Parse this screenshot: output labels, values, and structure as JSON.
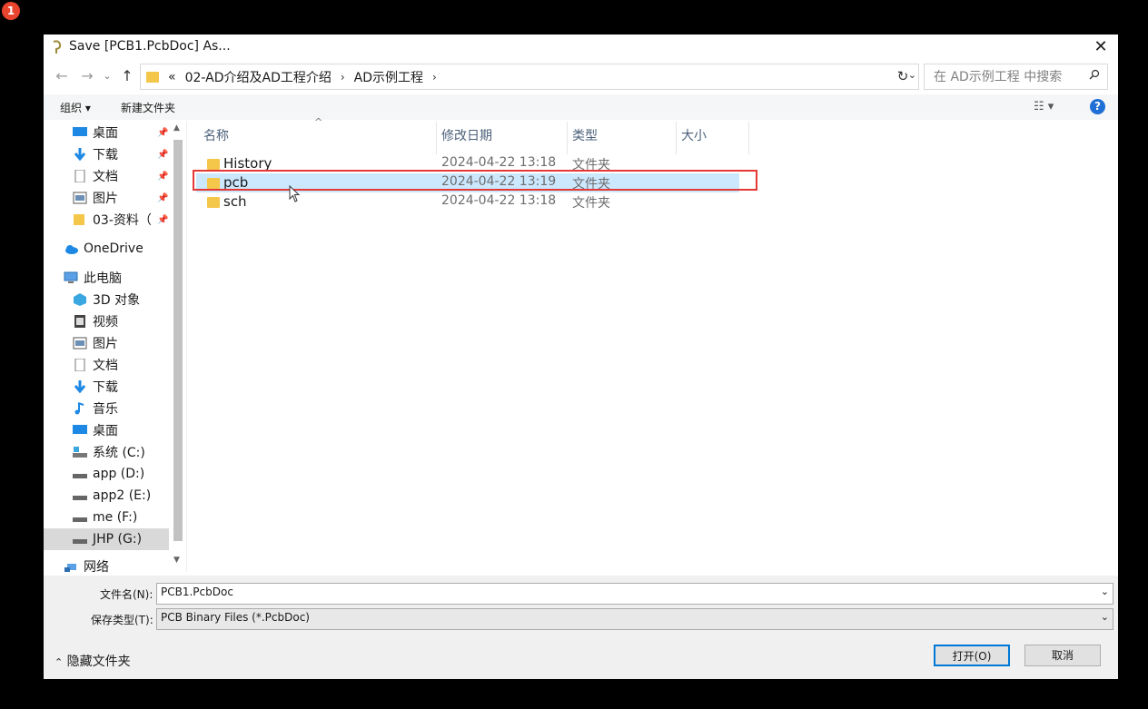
{
  "badge": "1",
  "window": {
    "title": "Save [PCB1.PcbDoc] As..."
  },
  "address": {
    "overflow": "«",
    "crumbs": [
      "02-AD介绍及AD工程介绍",
      "AD示例工程"
    ],
    "search_placeholder": "在 AD示例工程 中搜索"
  },
  "commands": {
    "organize": "组织 ▾",
    "new_folder": "新建文件夹"
  },
  "nav": {
    "quick": [
      {
        "label": "桌面",
        "icon": "desktop-icon"
      },
      {
        "label": "下载",
        "icon": "download-icon"
      },
      {
        "label": "文档",
        "icon": "document-icon"
      },
      {
        "label": "图片",
        "icon": "picture-icon"
      },
      {
        "label": "03-资料（",
        "icon": "folder-icon"
      }
    ],
    "onedrive": "OneDrive",
    "this_pc": "此电脑",
    "pc_items": [
      {
        "label": "3D 对象",
        "icon": "3d-objects-icon"
      },
      {
        "label": "视频",
        "icon": "video-icon"
      },
      {
        "label": "图片",
        "icon": "picture-icon"
      },
      {
        "label": "文档",
        "icon": "document-icon"
      },
      {
        "label": "下载",
        "icon": "download-icon"
      },
      {
        "label": "音乐",
        "icon": "music-icon"
      },
      {
        "label": "桌面",
        "icon": "desktop-icon"
      },
      {
        "label": "系统 (C:)",
        "icon": "drive-icon"
      },
      {
        "label": "app (D:)",
        "icon": "drive-icon"
      },
      {
        "label": "app2 (E:)",
        "icon": "drive-icon"
      },
      {
        "label": "me (F:)",
        "icon": "drive-icon"
      },
      {
        "label": "JHP (G:)",
        "icon": "drive-icon"
      }
    ],
    "network": "网络"
  },
  "columns": {
    "name": "名称",
    "date": "修改日期",
    "type": "类型",
    "size": "大小"
  },
  "files": [
    {
      "name": "History",
      "date": "2024-04-22 13:18",
      "type": "文件夹",
      "selected": false
    },
    {
      "name": "pcb",
      "date": "2024-04-22 13:19",
      "type": "文件夹",
      "selected": true
    },
    {
      "name": "sch",
      "date": "2024-04-22 13:18",
      "type": "文件夹",
      "selected": false
    }
  ],
  "form": {
    "filename_label": "文件名(N):",
    "filename_value": "PCB1.PcbDoc",
    "filetype_label": "保存类型(T):",
    "filetype_value": "PCB Binary Files (*.PcbDoc)"
  },
  "footer": {
    "hide_folders": "隐藏文件夹",
    "open": "打开(O)",
    "cancel": "取消"
  },
  "colors": {
    "accent": "#0078d7",
    "selection": "#cce8ff",
    "highlight_box": "#e53935",
    "folder": "#f4c64a"
  }
}
